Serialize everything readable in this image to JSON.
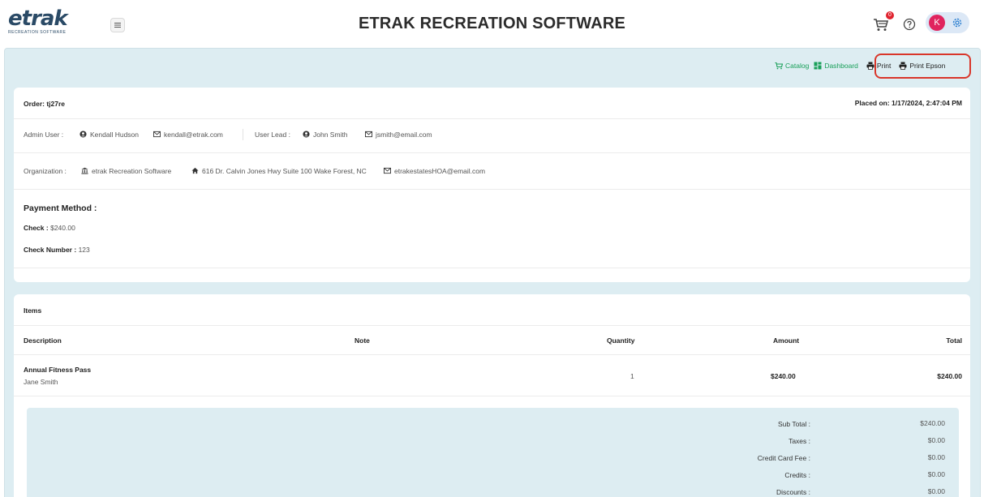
{
  "header": {
    "logo_text": "etrak",
    "logo_subtitle": "RECREATION SOFTWARE",
    "app_title": "ETRAK RECREATION SOFTWARE",
    "cart_count": "0",
    "avatar_initial": "K"
  },
  "actions": {
    "catalog": "Catalog",
    "dashboard": "Dashboard",
    "print": "Print",
    "print_epson": "Print Epson"
  },
  "order": {
    "order_label": "Order: tj27re",
    "placed_on": "Placed on: 1/17/2024, 2:47:04 PM",
    "admin_user_label": "Admin User :",
    "admin_user_name": "Kendall Hudson",
    "admin_user_email": "kendall@etrak.com",
    "user_lead_label": "User Lead :",
    "user_lead_name": "John Smith",
    "user_lead_email": "jsmith@email.com",
    "organization_label": "Organization :",
    "organization_name": "etrak Recreation Software",
    "organization_address": "616 Dr. Calvin Jones Hwy Suite 100 Wake Forest, NC",
    "organization_email": "etrakestatesHOA@email.com"
  },
  "payment": {
    "title": "Payment Method :",
    "check_label": "Check :",
    "check_value": "$240.00",
    "check_number_label": "Check Number :",
    "check_number_value": "123"
  },
  "items": {
    "title": "Items",
    "columns": {
      "description": "Description",
      "note": "Note",
      "quantity": "Quantity",
      "amount": "Amount",
      "total": "Total"
    },
    "rows": [
      {
        "description": "Annual Fitness Pass",
        "person": "Jane Smith",
        "note": "",
        "quantity": "1",
        "amount": "$240.00",
        "total": "$240.00"
      }
    ]
  },
  "totals": {
    "sub_total_label": "Sub Total :",
    "sub_total_value": "$240.00",
    "taxes_label": "Taxes :",
    "taxes_value": "$0.00",
    "cc_fee_label": "Credit Card Fee :",
    "cc_fee_value": "$0.00",
    "credits_label": "Credits :",
    "credits_value": "$0.00",
    "discounts_label": "Discounts :",
    "discounts_value": "$0.00"
  },
  "colors": {
    "accent_green": "#1aa05a",
    "panel_bg": "#ddedf2",
    "highlight_red": "#d9362a",
    "badge_red": "#e0242f",
    "avatar_pink": "#e0245e"
  }
}
